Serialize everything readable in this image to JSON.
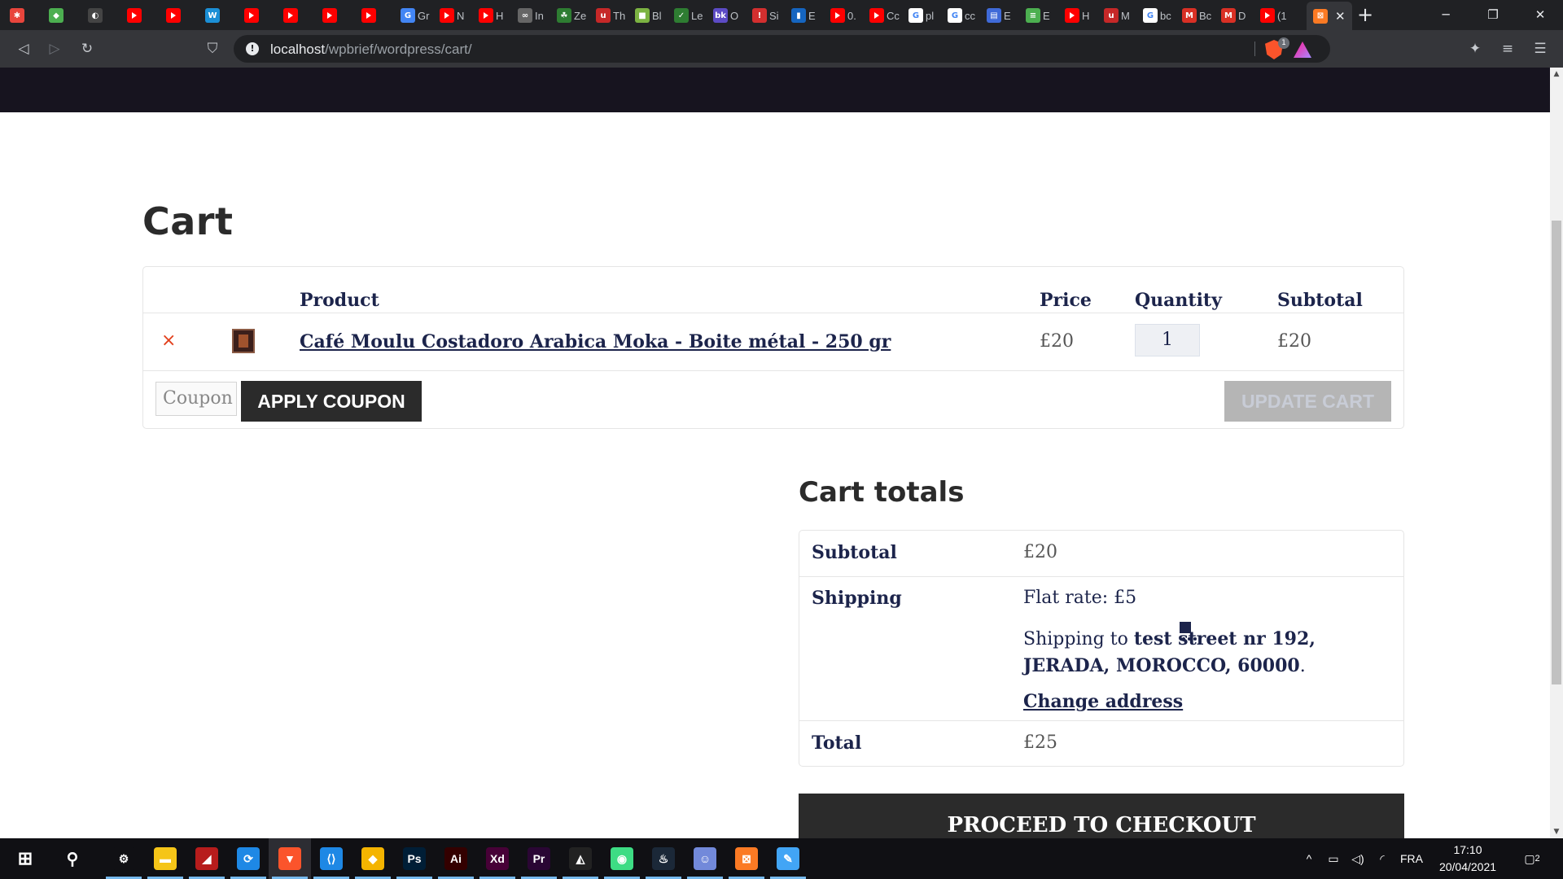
{
  "browser": {
    "tabs": [
      {
        "label": "",
        "color": "#e8453c",
        "glyph": "✱"
      },
      {
        "label": "",
        "color": "#4caf50",
        "glyph": "◆"
      },
      {
        "label": "",
        "color": "#444444",
        "glyph": "◐"
      },
      {
        "label": "",
        "color": "#ff0000",
        "glyph": "",
        "youtube": true
      },
      {
        "label": "",
        "color": "#ff0000",
        "glyph": "",
        "youtube": true
      },
      {
        "label": "",
        "color": "#1b8fd6",
        "glyph": "W"
      },
      {
        "label": "",
        "color": "#ff0000",
        "glyph": "",
        "youtube": true
      },
      {
        "label": "",
        "color": "#ff0000",
        "glyph": "",
        "youtube": true
      },
      {
        "label": "",
        "color": "#ff0000",
        "glyph": "",
        "youtube": true
      },
      {
        "label": "",
        "color": "#ff0000",
        "glyph": "",
        "youtube": true
      },
      {
        "label": "Gr",
        "color": "#4285f4",
        "glyph": "G"
      },
      {
        "label": "N",
        "color": "#ff0000",
        "glyph": "",
        "youtube": true
      },
      {
        "label": "H",
        "color": "#ff0000",
        "glyph": "",
        "youtube": true
      },
      {
        "label": "In",
        "color": "#666666",
        "glyph": "∞"
      },
      {
        "label": "Ze",
        "color": "#2e7d32",
        "glyph": "☘"
      },
      {
        "label": "Th",
        "color": "#c62828",
        "glyph": "u"
      },
      {
        "label": "Bl",
        "color": "#7cb342",
        "glyph": "■"
      },
      {
        "label": "Le",
        "color": "#2e7d32",
        "glyph": "✓"
      },
      {
        "label": "O",
        "color": "#5c4bc5",
        "glyph": "bk"
      },
      {
        "label": "Si",
        "color": "#d32f2f",
        "glyph": "!"
      },
      {
        "label": "E",
        "color": "#1565c0",
        "glyph": "▮"
      },
      {
        "label": "0.",
        "color": "#ff0000",
        "glyph": "",
        "youtube": true
      },
      {
        "label": "Cc",
        "color": "#ff0000",
        "glyph": "",
        "youtube": true
      },
      {
        "label": "pl",
        "color": "#ffffff",
        "glyph": "G"
      },
      {
        "label": "cc",
        "color": "#ffffff",
        "glyph": "G"
      },
      {
        "label": "E",
        "color": "#3f6ad8",
        "glyph": "▤"
      },
      {
        "label": "E",
        "color": "#4caf50",
        "glyph": "≡"
      },
      {
        "label": "H",
        "color": "#ff0000",
        "glyph": "",
        "youtube": true
      },
      {
        "label": "M",
        "color": "#c62828",
        "glyph": "u"
      },
      {
        "label": "bc",
        "color": "#ffffff",
        "glyph": "G"
      },
      {
        "label": "Bc",
        "color": "#d93025",
        "glyph": "M"
      },
      {
        "label": "D",
        "color": "#d93025",
        "glyph": "M"
      },
      {
        "label": "(1",
        "color": "#ff0000",
        "glyph": "",
        "youtube": true
      }
    ],
    "active_tab": {
      "label": "",
      "color": "#fb7a24",
      "glyph": "⊠"
    },
    "url_host": "localhost",
    "url_path": "/wpbrief/wordpress/cart/",
    "shield_count": "1"
  },
  "page": {
    "title": "Cart",
    "table": {
      "headers": {
        "product": "Product",
        "price": "Price",
        "quantity": "Quantity",
        "subtotal": "Subtotal"
      },
      "item": {
        "remove": "×",
        "name": "Café Moulu Costadoro Arabica Moka - Boite métal - 250 gr",
        "price": "£20",
        "quantity": "1",
        "subtotal": "£20"
      },
      "coupon_placeholder": "Coupon",
      "apply_coupon": "APPLY COUPON",
      "update_cart": "UPDATE CART"
    },
    "totals": {
      "title": "Cart totals",
      "subtotal_label": "Subtotal",
      "subtotal_value": "£20",
      "shipping_label": "Shipping",
      "shipping_method": "Flat rate: £5",
      "shipping_to_prefix": "Shipping to ",
      "shipping_address": "test street nr 192, JERADA, MOROCCO, 60000",
      "shipping_suffix": ".",
      "change_address": "Change address",
      "total_label": "Total",
      "total_value": "£25",
      "checkout": "PROCEED TO CHECKOUT"
    }
  },
  "taskbar": {
    "apps": [
      {
        "name": "settings",
        "color": "#101014",
        "glyph": "⚙"
      },
      {
        "name": "file-explorer",
        "color": "#f5c518",
        "glyph": "▬"
      },
      {
        "name": "app-red",
        "color": "#b71c1c",
        "glyph": "◢"
      },
      {
        "name": "bluetooth-app",
        "color": "#1e88e5",
        "glyph": "⟳"
      },
      {
        "name": "brave",
        "color": "#fb542b",
        "glyph": "▼",
        "active": true
      },
      {
        "name": "vscode",
        "color": "#1e88e5",
        "glyph": "⟨⟩"
      },
      {
        "name": "git",
        "color": "#f4b400",
        "glyph": "◆"
      },
      {
        "name": "photoshop",
        "color": "#001e36",
        "glyph": "Ps"
      },
      {
        "name": "illustrator",
        "color": "#330000",
        "glyph": "Ai"
      },
      {
        "name": "xd",
        "color": "#470137",
        "glyph": "Xd"
      },
      {
        "name": "premiere",
        "color": "#2a0634",
        "glyph": "Pr"
      },
      {
        "name": "unity",
        "color": "#222222",
        "glyph": "◭"
      },
      {
        "name": "android-studio",
        "color": "#3ddc84",
        "glyph": "◉"
      },
      {
        "name": "steam",
        "color": "#1b2838",
        "glyph": "♨"
      },
      {
        "name": "discord",
        "color": "#7289da",
        "glyph": "☺"
      },
      {
        "name": "xampp",
        "color": "#fb7a24",
        "glyph": "⊠"
      },
      {
        "name": "paint",
        "color": "#42a5f5",
        "glyph": "✎"
      }
    ],
    "language": "FRA",
    "time": "17:10",
    "date": "20/04/2021",
    "notifications": "2"
  }
}
